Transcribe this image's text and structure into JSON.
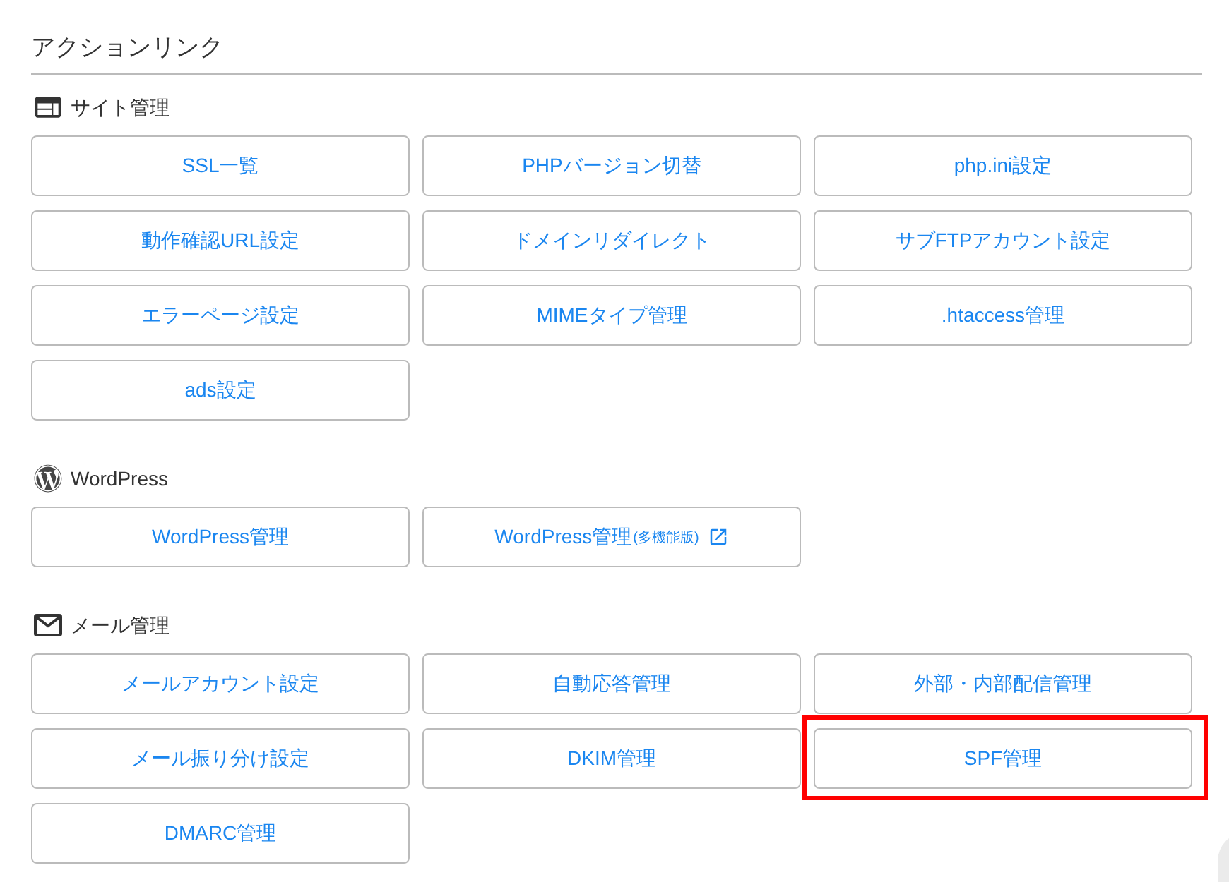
{
  "title": "アクションリンク",
  "sections": [
    {
      "kind": "site",
      "heading": "サイト管理",
      "buttons": [
        {
          "label": "SSL一覧",
          "external": false,
          "highlighted": false
        },
        {
          "label": "PHPバージョン切替",
          "external": false,
          "highlighted": false
        },
        {
          "label": "php.ini設定",
          "external": false,
          "highlighted": false
        },
        {
          "label": "動作確認URL設定",
          "external": false,
          "highlighted": false
        },
        {
          "label": "ドメインリダイレクト",
          "external": false,
          "highlighted": false
        },
        {
          "label": "サブFTPアカウント設定",
          "external": false,
          "highlighted": false
        },
        {
          "label": "エラーページ設定",
          "external": false,
          "highlighted": false
        },
        {
          "label": "MIMEタイプ管理",
          "external": false,
          "highlighted": false
        },
        {
          "label": ".htaccess管理",
          "external": false,
          "highlighted": false
        },
        {
          "label": "ads設定",
          "external": false,
          "highlighted": false
        }
      ]
    },
    {
      "kind": "wordpress",
      "heading": "WordPress",
      "buttons": [
        {
          "label": "WordPress管理",
          "external": false,
          "highlighted": false
        },
        {
          "label": "WordPress管理",
          "note": "(多機能版)",
          "external": true,
          "highlighted": false
        }
      ]
    },
    {
      "kind": "mail",
      "heading": "メール管理",
      "buttons": [
        {
          "label": "メールアカウント設定",
          "external": false,
          "highlighted": false
        },
        {
          "label": "自動応答管理",
          "external": false,
          "highlighted": false
        },
        {
          "label": "外部・内部配信管理",
          "external": false,
          "highlighted": false
        },
        {
          "label": "メール振り分け設定",
          "external": false,
          "highlighted": false
        },
        {
          "label": "DKIM管理",
          "external": false,
          "highlighted": false
        },
        {
          "label": "SPF管理",
          "external": false,
          "highlighted": true
        },
        {
          "label": "DMARC管理",
          "external": false,
          "highlighted": false
        }
      ]
    }
  ]
}
